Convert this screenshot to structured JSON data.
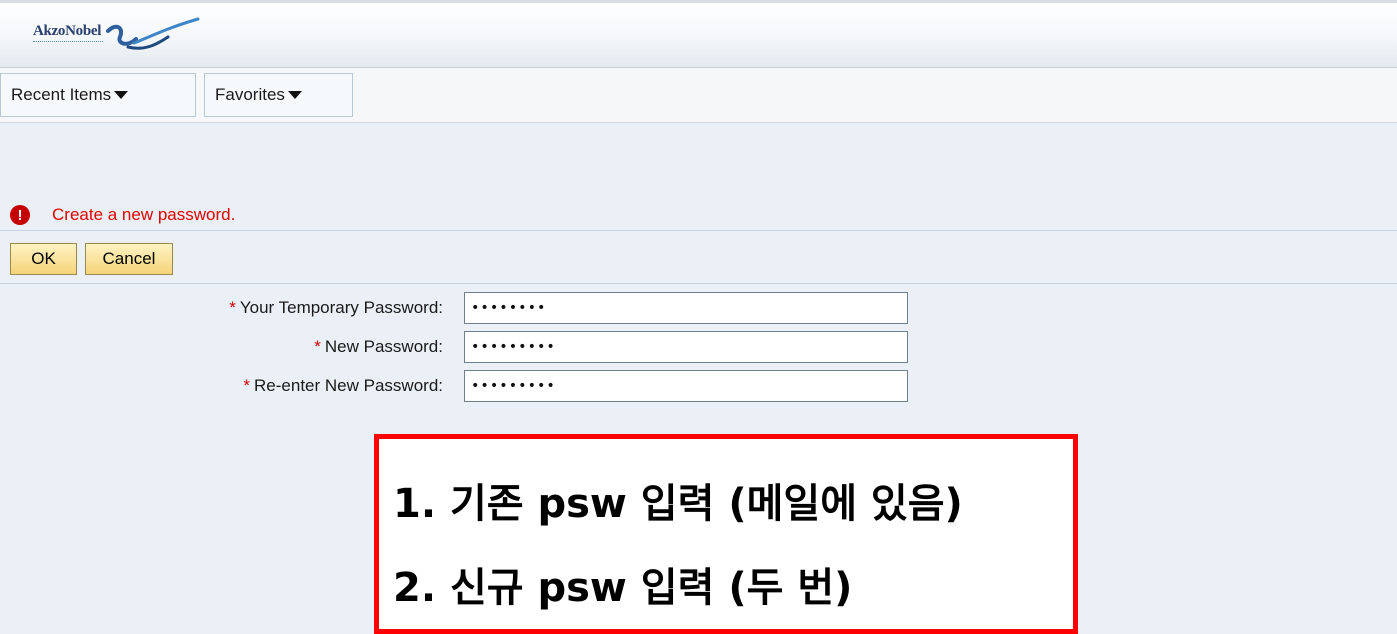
{
  "header": {
    "logo_text": "AkzoNobel"
  },
  "nav": {
    "tabs": [
      {
        "label": "Recent Items"
      },
      {
        "label": "Favorites"
      }
    ]
  },
  "message": {
    "text": "Create a new password.",
    "icon": "error-icon",
    "color": "#e00000"
  },
  "toolbar": {
    "ok_label": "OK",
    "cancel_label": "Cancel"
  },
  "form": {
    "required_marker": "*",
    "fields": [
      {
        "label": "Your Temporary Password:",
        "value": "••••••••"
      },
      {
        "label": "New Password:",
        "value": "•••••••••"
      },
      {
        "label": "Re-enter New Password:",
        "value": "•••••••••"
      }
    ]
  },
  "annotation": {
    "line1": "1. 기존 psw 입력 (메일에 있음)",
    "line2": "2. 신규 psw 입력 (두 번)",
    "border_color": "#ff0000"
  }
}
